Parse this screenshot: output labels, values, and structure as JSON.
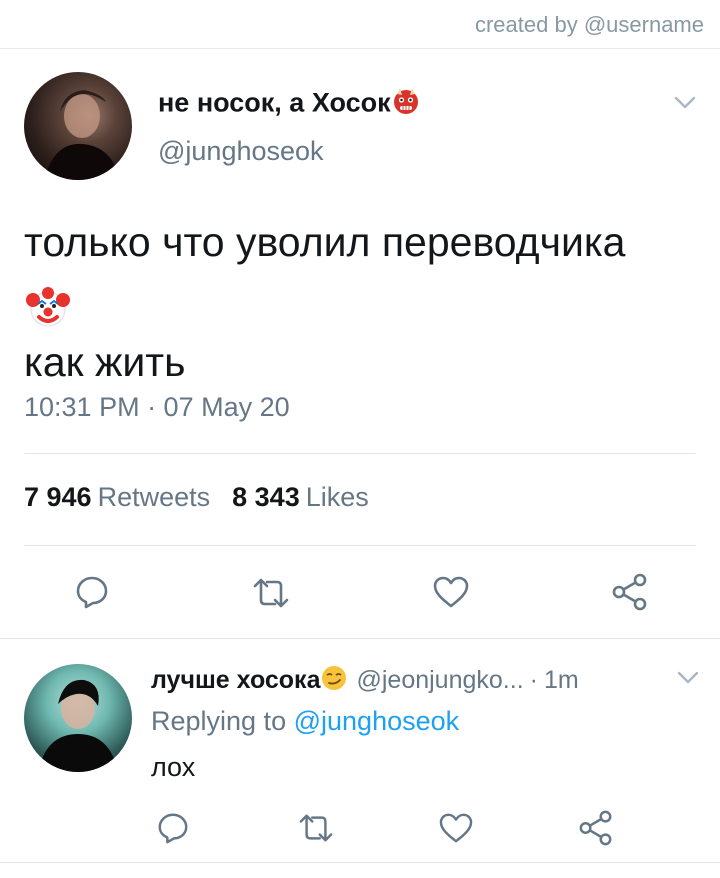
{
  "header": {
    "credit": "created by @username"
  },
  "tweet": {
    "display_name": "не носок, а Хосок",
    "name_emoji": "ogre-emoji",
    "handle": "@junghoseok",
    "text_line1": "только что уволил переводчика",
    "text_emoji": "clown-face-emoji",
    "text_line3": "как жить",
    "timestamp": "10:31 PM · 07 May 20",
    "retweets_count": "7 946",
    "retweets_label": "Retweets",
    "likes_count": "8 343",
    "likes_label": "Likes",
    "actions": [
      "reply-icon",
      "retweet-icon",
      "like-icon",
      "share-icon"
    ]
  },
  "reply": {
    "display_name": "лучше хосока",
    "name_emoji": "smirking-face-emoji",
    "handle": "@jeonjungko...",
    "separator": "·",
    "time": "1m",
    "replying_prefix": "Replying to",
    "replying_to": "@junghoseok",
    "text": "лох"
  },
  "colors": {
    "text": "#14171a",
    "secondary": "#657786",
    "accent": "#1da1f2",
    "divider": "#e1e8ed"
  }
}
